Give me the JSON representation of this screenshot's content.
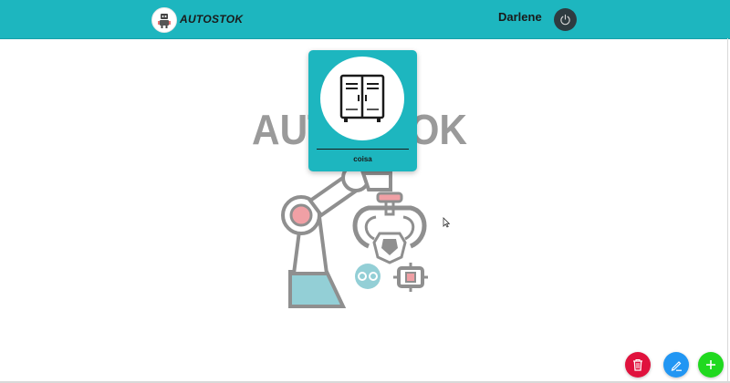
{
  "header": {
    "app_name": "AUTOSTOK",
    "user_name": "Darlene",
    "logo_icon": "robot-mascot-icon",
    "power_icon": "power-icon",
    "background_color": "#1db6bf"
  },
  "background": {
    "watermark_text": "AUTOSTOK",
    "illustration": "robotic-arm-illustration",
    "watermark_color": "#9a9a9a"
  },
  "cards": [
    {
      "label": "coisa",
      "icon": "locker-icon"
    }
  ],
  "actions": {
    "delete_icon": "trash-icon",
    "edit_icon": "pencil-icon",
    "add_icon": "plus-icon",
    "delete_color": "#e0123d",
    "edit_color": "#2196f3",
    "add_color": "#20d91f"
  }
}
